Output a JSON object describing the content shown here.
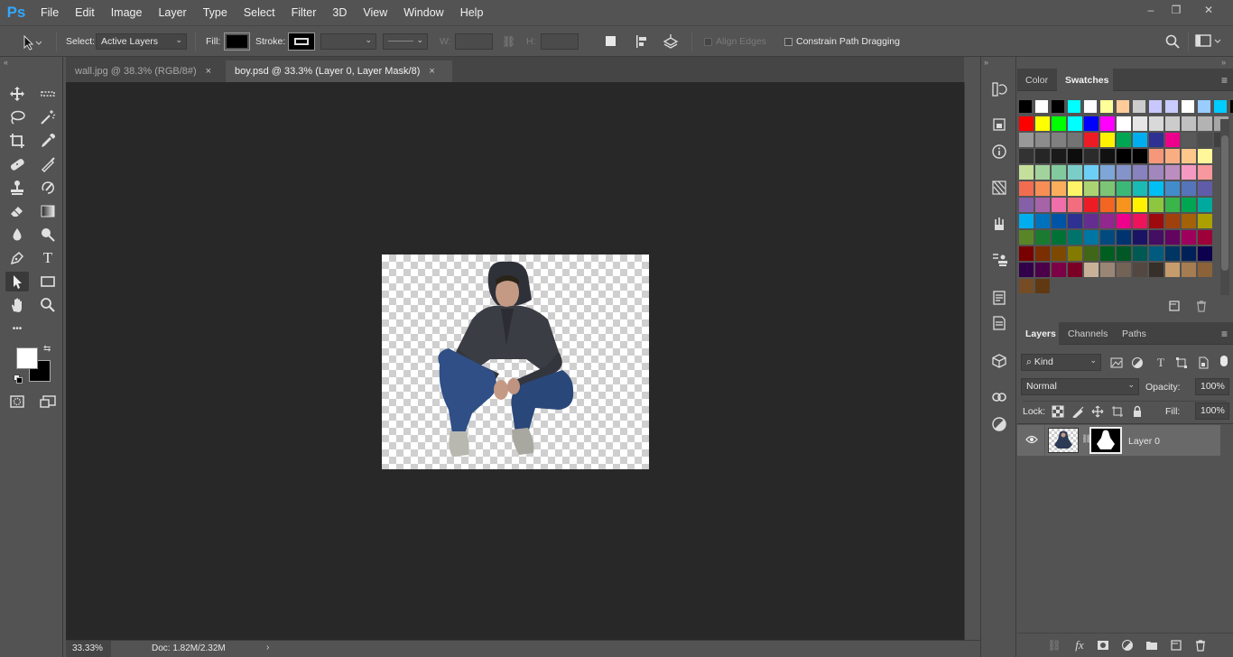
{
  "app": {
    "logo": "Ps"
  },
  "menu": [
    "File",
    "Edit",
    "Image",
    "Layer",
    "Type",
    "Select",
    "Filter",
    "3D",
    "View",
    "Window",
    "Help"
  ],
  "window_controls": {
    "minimize": "–",
    "restore": "❐",
    "close": "✕"
  },
  "options_bar": {
    "select_label": "Select:",
    "select_value": "Active Layers",
    "fill_label": "Fill:",
    "fill_color": "#000000",
    "stroke_label": "Stroke:",
    "w_label": "W:",
    "h_label": "H:",
    "align_edges_label": "Align Edges",
    "constrain_label": "Constrain Path Dragging"
  },
  "tabs": [
    {
      "label": "wall.jpg @ 38.3% (RGB/8#)",
      "active": false,
      "close": "×"
    },
    {
      "label": "boy.psd @ 33.3% (Layer 0, Layer Mask/8)",
      "active": true,
      "close": "×"
    }
  ],
  "status": {
    "zoom": "33.33%",
    "doc_info": "Doc: 1.82M/2.32M",
    "more": "›"
  },
  "colors": {
    "foreground": "#ffffff",
    "background": "#000000",
    "accent": "#31a8ff"
  },
  "color_panel": {
    "tabs": [
      "Color",
      "Swatches"
    ],
    "active_tab": "Swatches",
    "swatches": [
      [
        "#000000",
        "#ffffff",
        "#000000",
        "#00ffff",
        "#ffffff",
        "#ffff99",
        "#ffcc99",
        "#cccccc",
        "#c8c8ff",
        "#c8ccff",
        "#ffffff",
        "#99ccff",
        "#00ccff",
        "#000000"
      ],
      [
        "#ff0000",
        "#ffff00",
        "#00ff00",
        "#00ffff",
        "#0000ff",
        "#ff00ff",
        "#ffffff",
        "#e6e6e6",
        "#d9d9d9",
        "#cccccc",
        "#c0c0c0",
        "#b3b3b3",
        "#a6a6a6"
      ],
      [
        "#999999",
        "#8c8c8c",
        "#808080",
        "#737373",
        "#ed1c24",
        "#fff200",
        "#00a651",
        "#00aeef",
        "#2e3192",
        "#ec008c",
        "#595959",
        "#4d4d4d",
        "#404040"
      ],
      [
        "#333333",
        "#262626",
        "#1a1a1a",
        "#0d0d0d",
        "#2b2b2b",
        "#111111",
        "#000000",
        "#000000",
        "#f7977a",
        "#f9ad81",
        "#fdc68a",
        "#fff79a"
      ],
      [
        "#c4df9b",
        "#a3d39c",
        "#82ca9d",
        "#7bcdc8",
        "#6ecff6",
        "#7ea7d8",
        "#8493ca",
        "#8882be",
        "#a187be",
        "#bc8dbf",
        "#f49ac2",
        "#f6989d"
      ],
      [
        "#f26c4f",
        "#f68e55",
        "#fbaf5c",
        "#fff467",
        "#acd372",
        "#7cc576",
        "#3bb878",
        "#1abbb4",
        "#00bff3",
        "#438ccb",
        "#5574b9",
        "#605ca8"
      ],
      [
        "#855fa8",
        "#a763a8",
        "#f06ea9",
        "#f26d7d",
        "#ed1c24",
        "#f26522",
        "#f7941d",
        "#fff200",
        "#8dc63f",
        "#39b54a",
        "#00a651",
        "#00a99d"
      ],
      [
        "#00aeef",
        "#0072bc",
        "#0054a6",
        "#2e3192",
        "#662d91",
        "#92278f",
        "#ec008c",
        "#ed145b",
        "#9e0b0f",
        "#a0410d",
        "#a3620a",
        "#aba000"
      ],
      [
        "#598527",
        "#1a7b30",
        "#007236",
        "#00746b",
        "#0076a3",
        "#004a80",
        "#003471",
        "#1b1464",
        "#440e62",
        "#630460",
        "#9e005d",
        "#9e0039"
      ],
      [
        "#790000",
        "#7b2e00",
        "#7d4900",
        "#827b00",
        "#406618",
        "#005e20",
        "#005826",
        "#005952",
        "#005b7f",
        "#003663",
        "#002157",
        "#0d004c"
      ],
      [
        "#32004b",
        "#4b0049",
        "#7b0046",
        "#7a0026",
        "#c7b299",
        "#998675",
        "#736357",
        "#534741",
        "#37302a",
        "#c69c6d",
        "#a67c52",
        "#8c6239"
      ],
      [
        "#754c24",
        "#603913"
      ]
    ]
  },
  "layers_panel": {
    "tabs": [
      "Layers",
      "Channels",
      "Paths"
    ],
    "active_tab": "Layers",
    "kind_label": "Kind",
    "blend_mode": "Normal",
    "opacity_label": "Opacity:",
    "opacity_value": "100%",
    "lock_label": "Lock:",
    "fill_label": "Fill:",
    "fill_value": "100%",
    "layers": [
      {
        "name": "Layer 0",
        "visible": true
      }
    ],
    "footer_icons": [
      "link-icon",
      "fx-icon",
      "mask-icon",
      "adjustment-icon",
      "group-icon",
      "new-layer-icon",
      "trash-icon"
    ],
    "fx_label": "fx"
  },
  "toolbar": {
    "tools": [
      "move",
      "artboard",
      "lasso",
      "magic-wand",
      "crop",
      "eyedropper",
      "healing-brush",
      "brush",
      "clone-stamp",
      "history-brush",
      "eraser",
      "gradient",
      "blur",
      "dodge",
      "pen",
      "type",
      "path-selection",
      "rectangle",
      "hand",
      "zoom"
    ],
    "active_tool": "path-selection",
    "type_glyph": "T",
    "more_glyph": "•••"
  }
}
